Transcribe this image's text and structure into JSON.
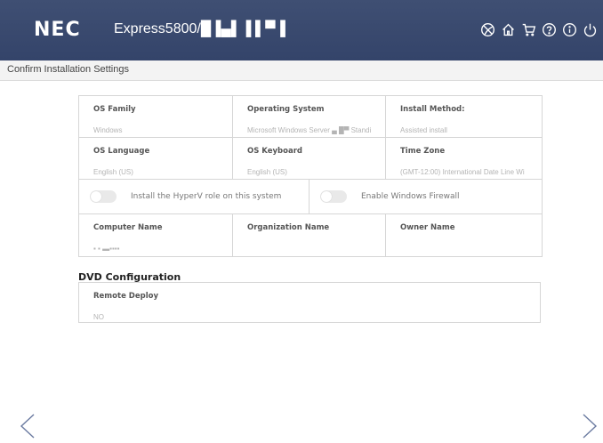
{
  "header": {
    "logo": "NEC",
    "product": "Express5800/█▐▄▌▐ ▌▀▐",
    "icons": [
      "globe-icon",
      "home-icon",
      "cart-icon",
      "help-icon",
      "info-icon",
      "power-icon"
    ]
  },
  "subbar": {
    "title": "Confirm Installation Settings"
  },
  "settings": {
    "os_family": {
      "label": "OS Family",
      "value": "Windows"
    },
    "operating_system": {
      "label": "Operating System",
      "value": "Microsoft Windows Server ▄ █▀ Standi"
    },
    "install_method": {
      "label": "Install Method:",
      "value": "Assisted install"
    },
    "os_language": {
      "label": "OS Language",
      "value": "English (US)"
    },
    "os_keyboard": {
      "label": "OS Keyboard",
      "value": "English (US)"
    },
    "time_zone": {
      "label": "Time Zone",
      "value": "(GMT-12:00) International Date Line Wi"
    },
    "hyperv_toggle": {
      "label": "Install the HyperV role on this system"
    },
    "firewall_toggle": {
      "label": "Enable Windows Firewall"
    },
    "computer_name": {
      "label": "Computer Name",
      "value": "▪ ▪  ▬▪▪▪▪"
    },
    "organization_name": {
      "label": "Organization Name",
      "value": ""
    },
    "owner_name": {
      "label": "Owner Name",
      "value": ""
    }
  },
  "dvd": {
    "title": "DVD Configuration",
    "remote_deploy": {
      "label": "Remote Deploy",
      "value": "NO"
    }
  },
  "colors": {
    "header_bg": "#3a4a6e",
    "nav_arrow": "#6a7aa0"
  }
}
